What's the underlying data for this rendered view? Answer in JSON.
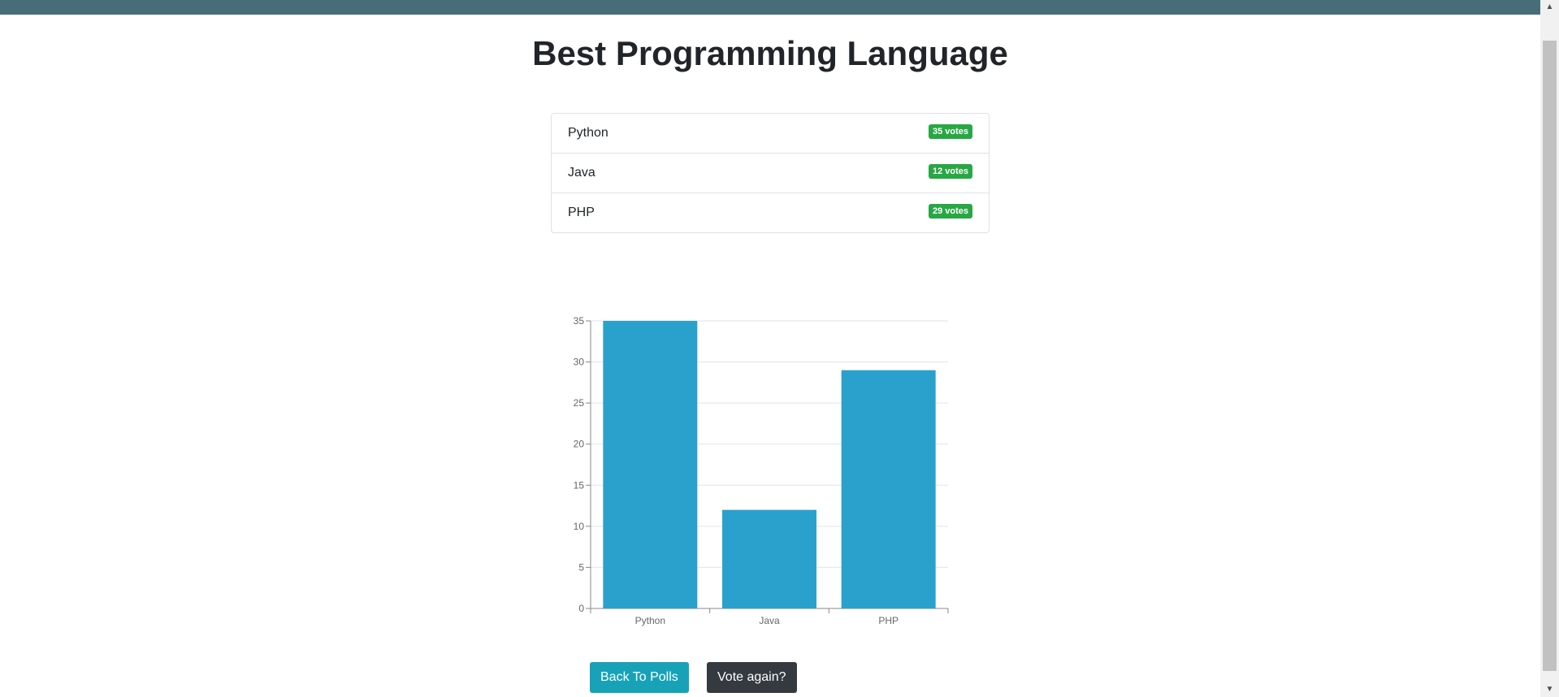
{
  "page": {
    "title": "Best Programming Language"
  },
  "votes": [
    {
      "label": "Python",
      "badge": "35 votes"
    },
    {
      "label": "Java",
      "badge": "12 votes"
    },
    {
      "label": "PHP",
      "badge": "29 votes"
    }
  ],
  "buttons": {
    "back": "Back To Polls",
    "vote_again": "Vote again?"
  },
  "colors": {
    "bar": "#2aa1cc",
    "badge": "#28a745",
    "back_button": "#17a2b8",
    "vote_button": "#343a40",
    "topbar": "#476e78"
  },
  "chart_data": {
    "type": "bar",
    "categories": [
      "Python",
      "Java",
      "PHP"
    ],
    "values": [
      35,
      12,
      29
    ],
    "ylim": [
      0,
      35
    ],
    "yticks": [
      "0",
      "5",
      "10",
      "15",
      "20",
      "25",
      "30",
      "35"
    ],
    "grid": true,
    "legend": "none",
    "title": "",
    "xlabel": "",
    "ylabel": ""
  }
}
